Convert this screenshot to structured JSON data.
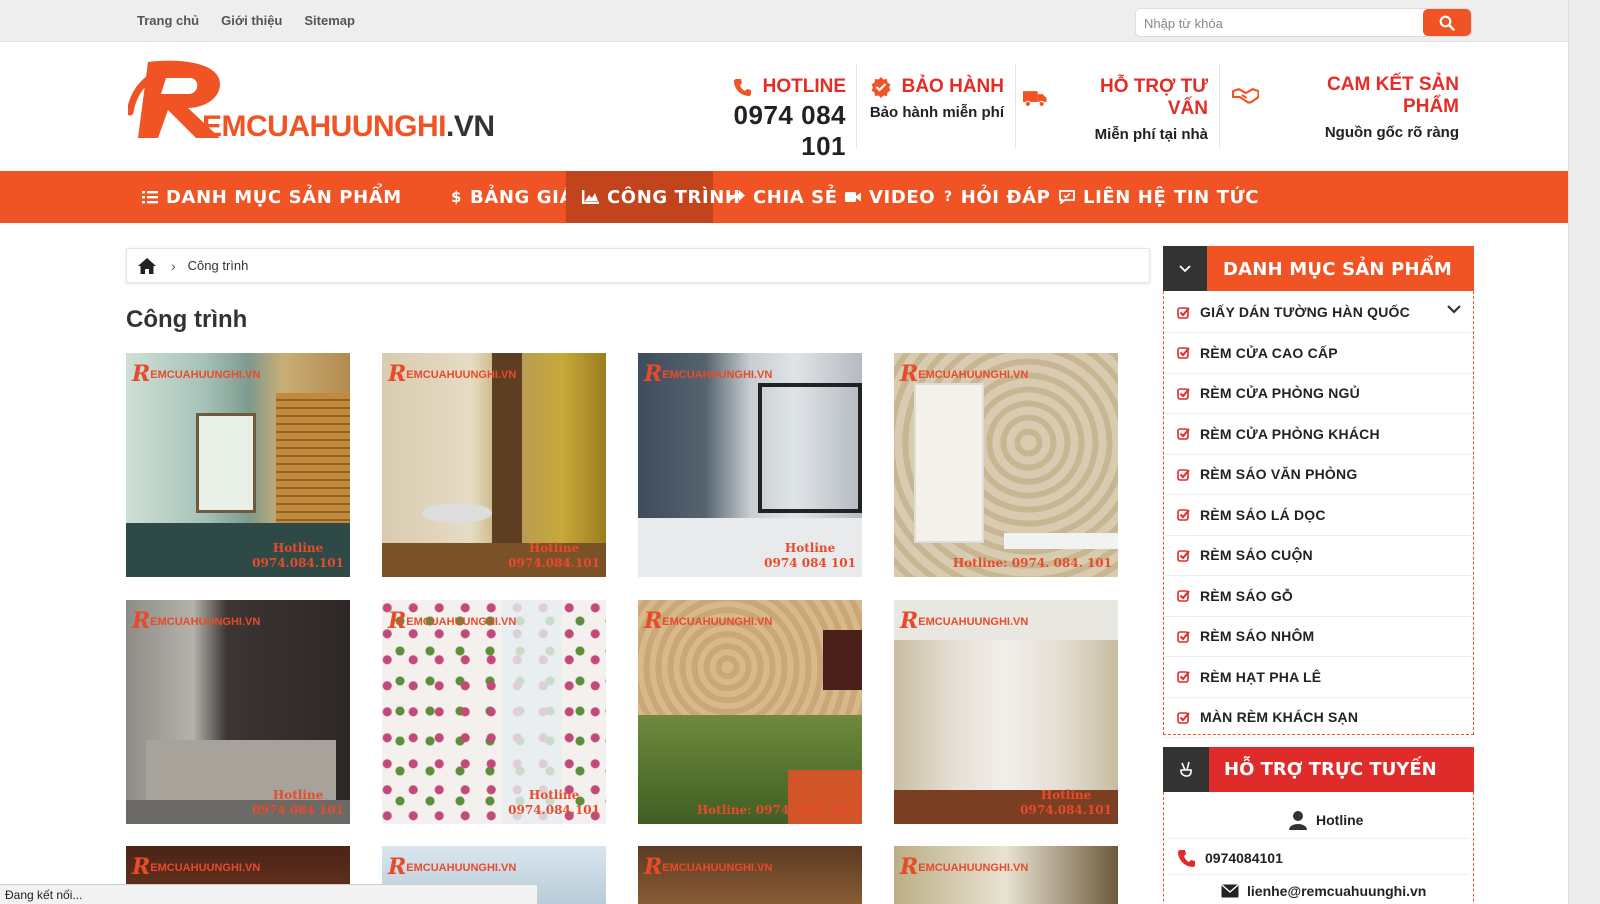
{
  "topbar": {
    "links": [
      "Trang chủ",
      "Giới thiệu",
      "Sitemap"
    ],
    "search_placeholder": "Nhập từ khóa"
  },
  "logo": {
    "letter": "R",
    "text_main": "EMCUAHUUNGHI",
    "text_suffix": ".VN"
  },
  "header": {
    "hotline": {
      "title": "HOTLINE",
      "value": "0974 084 101"
    },
    "warranty": {
      "title": "BẢO HÀNH",
      "sub": "Bảo hành miễn phí"
    },
    "support": {
      "title": "HỖ TRỢ TƯ VẤN",
      "sub": "Miễn phí tại nhà"
    },
    "commit": {
      "title": "CAM KẾT SẢN PHẨM",
      "sub": "Nguồn gốc rõ ràng"
    }
  },
  "nav": {
    "items": [
      "DANH MỤC SẢN PHẨM",
      "BẢNG GIÁ",
      "CÔNG TRÌNH",
      "CHIA SẺ",
      "VIDEO",
      "HỎI ĐÁP",
      "LIÊN HỆ",
      "TIN TỨC"
    ],
    "active_index": 2,
    "accent": "#f05424",
    "active_color": "#c2441c"
  },
  "breadcrumb": {
    "current": "Công trình"
  },
  "page_title": "Công trình",
  "gallery": {
    "watermark_letter": "R",
    "watermark_text": "EMCUAHUUNGHI.VN",
    "captions": [
      [
        "Hotline",
        "0974.084.101"
      ],
      [
        "Hotline",
        "0974.084.101"
      ],
      [
        "Hotline",
        "0974 084 101"
      ],
      [
        "Hotline: 0974. 084. 101"
      ],
      [
        "Hotline",
        "0974 084 101"
      ],
      [
        "Hotline",
        "0974.084.101"
      ],
      [
        "Hotline: 0974. 084. 101"
      ],
      [
        "Hotline",
        "0974.084.101"
      ]
    ]
  },
  "sidebar": {
    "categories_title": "DANH MỤC SẢN PHẨM",
    "categories": [
      "GIẤY DÁN TƯỜNG HÀN QUỐC",
      "RÈM CỬA CAO CẤP",
      "RÈM CỬA PHÒNG NGỦ",
      "RÈM CỬA PHÒNG KHÁCH",
      "RÈM SÁO VĂN PHÒNG",
      "RÈM SÁO LÁ DỌC",
      "RÈM SÁO CUỘN",
      "RÈM SÁO GỖ",
      "RÈM SÁO NHÔM",
      "RÈM HẠT PHA LÊ",
      "MÀN RÈM KHÁCH SẠN"
    ],
    "support_title": "HỖ TRỢ TRỰC TUYẾN",
    "support_name": "Hotline",
    "support_phone": "0974084101",
    "support_email": "lienhe@remcuahuunghi.vn"
  },
  "status_text": "Đang kết nối..."
}
